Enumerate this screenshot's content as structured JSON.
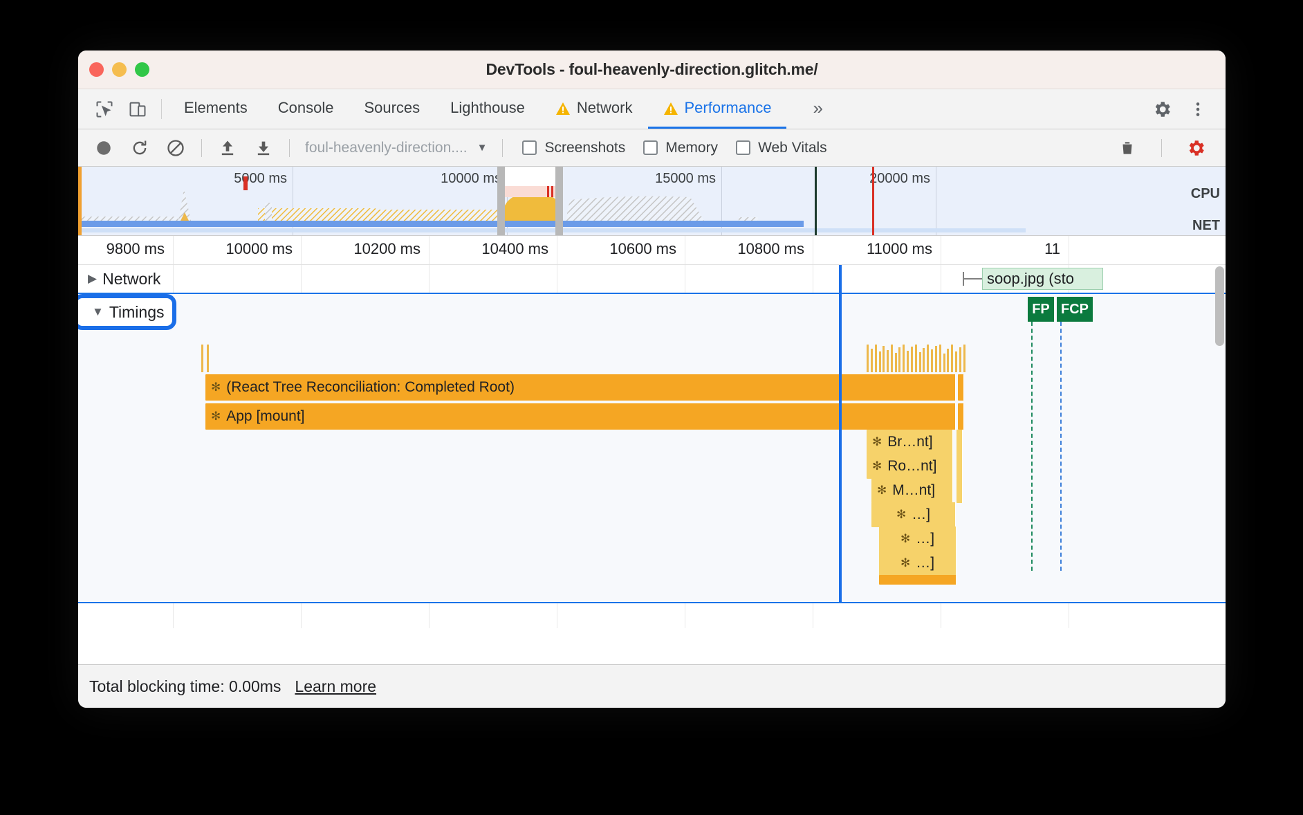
{
  "window": {
    "title": "DevTools - foul-heavenly-direction.glitch.me/",
    "traffic": {
      "close": "close-button",
      "minimize": "minimize-button",
      "maximize": "maximize-button"
    }
  },
  "devtools_tabs": {
    "inspect_icon": "inspect-element-icon",
    "device_icon": "device-toolbar-icon",
    "items": [
      {
        "label": "Elements",
        "warning": false,
        "active": false
      },
      {
        "label": "Console",
        "warning": false,
        "active": false
      },
      {
        "label": "Sources",
        "warning": false,
        "active": false
      },
      {
        "label": "Lighthouse",
        "warning": false,
        "active": false
      },
      {
        "label": "Network",
        "warning": true,
        "active": false
      },
      {
        "label": "Performance",
        "warning": true,
        "active": true
      }
    ],
    "more_label": "»",
    "settings_icon": "gear-icon",
    "menu_icon": "kebab-menu-icon",
    "accent_color": "#1a73e8",
    "warning_color": "#f5b400"
  },
  "perf_toolbar": {
    "record_label": "record-button",
    "reload_label": "reload-and-record-button",
    "clear_label": "clear-button",
    "load_label": "load-profile-button",
    "save_label": "save-profile-button",
    "url_value": "foul-heavenly-direction....",
    "url_caret": "▼",
    "checkboxes": [
      {
        "label": "Screenshots",
        "checked": false
      },
      {
        "label": "Memory",
        "checked": false
      },
      {
        "label": "Web Vitals",
        "checked": false
      }
    ],
    "trash_label": "delete-button",
    "capture_settings_label": "capture-settings-gear",
    "capture_settings_color": "#d93025"
  },
  "overview": {
    "tick_labels": [
      "5000 ms",
      "10000 ms",
      "15000 ms",
      "20000 ms"
    ],
    "cpu_label": "CPU",
    "net_label": "NET"
  },
  "timeline": {
    "ruler_ticks": [
      "9800 ms",
      "10000 ms",
      "10200 ms",
      "10400 ms",
      "10600 ms",
      "10800 ms",
      "11000 ms",
      "11"
    ],
    "tracks": [
      {
        "name": "Network",
        "label": "Network",
        "arrow": "▶",
        "expanded": false
      },
      {
        "name": "Timings",
        "label": "Timings",
        "arrow": "▼",
        "expanded": true,
        "highlighted": true
      }
    ],
    "network_request": {
      "label": "soop.jpg (sto"
    },
    "markers": [
      {
        "label": "FP"
      },
      {
        "label": "FCP"
      }
    ],
    "flame_bars": [
      {
        "label": "(React Tree Reconciliation: Completed Root)",
        "icon": "✻",
        "shade": "dark"
      },
      {
        "label": "App [mount]",
        "icon": "✻",
        "shade": "dark"
      },
      {
        "label": "Br…nt]",
        "icon": "✻",
        "shade": "light"
      },
      {
        "label": "Ro…nt]",
        "icon": "✻",
        "shade": "light"
      },
      {
        "label": "M…nt]",
        "icon": "✻",
        "shade": "light"
      },
      {
        "label": "…]",
        "icon": "✻",
        "shade": "light"
      },
      {
        "label": "…]",
        "icon": "✻",
        "shade": "light"
      },
      {
        "label": "…]",
        "icon": "✻",
        "shade": "light"
      }
    ]
  },
  "footer": {
    "total_blocking_time": "Total blocking time: 0.00ms",
    "learn_more": "Learn more"
  },
  "colors": {
    "flame_dark": "#f5a623",
    "flame_light": "#f6d26a",
    "selection_line": "#1a6ee8",
    "marker_green": "#0b7a3e"
  }
}
